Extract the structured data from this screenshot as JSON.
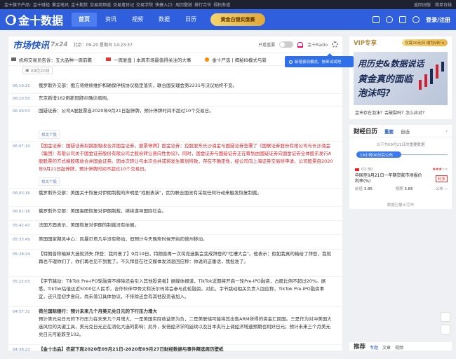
{
  "topbar": {
    "left": [
      "金十旗下产品:",
      "金十财经",
      "黄金电讯",
      "金十期货",
      "交易商频道",
      "交易者日记",
      "交易学院",
      "快捷入口:",
      "周历壁纸",
      "排行合伙",
      "视机有道"
    ],
    "right": [
      "返回旧版",
      "简单台线"
    ]
  },
  "nav": {
    "logo": "金十数据",
    "items": [
      "首页",
      "资讯",
      "视频",
      "数据",
      "日历"
    ],
    "active": 0,
    "promo": "黄金白银实盘赛",
    "login": "登录/注册"
  },
  "panel": {
    "brand": "市场快讯",
    "brand_sub": "7x24",
    "date": "北京：09-20 星期日 14:23:37",
    "important_label": "只看重要",
    "radio_label": "金十Radio",
    "tooltip": "新增夜间模式，快来试试吧",
    "ticker": [
      {
        "flag": "w",
        "text": "机构交易员告诉：五大品种一周前瞻"
      },
      {
        "flag": "r",
        "text": "一周复盘 | 本周市场最值得关注的大事"
      },
      {
        "flag": "c",
        "text": "金十严选 | 揭秘IB模式与新"
      }
    ],
    "date_filter": "09月20日"
  },
  "feed": [
    {
      "time": "06:19:21",
      "text": "俄罗斯外交部：俄方将继续维护和确保停核协议稳定落实，联合国安理会第2231号决议始终不变。",
      "style": "",
      "rel": ""
    },
    {
      "time": "06:10:50",
      "text": "东京新增162例新冠肺炎确诊病例。",
      "style": "",
      "rel": ""
    },
    {
      "time": "06:09:53",
      "text": "国疑证券：公司A股股票自2020年9月21日起停牌，预计停牌时间不超过10个交易日。",
      "style": "",
      "rel": "相关个股"
    },
    {
      "time": "06:07:10",
      "text": "【国金证券：国疑证券拟换股吸收合并国金证券，股票停牌】国金证券：控股股东长沙涌金与国疑证券签署了《国联证券股份有限公司与长沙涌金（集团）有限公司关于国金证券股份有限公司之股份转让意向性协议》，同时，国金证券与国疑证券正在筹划由国疑证券向国金证券全体股东发行A股股票的方式换股吸收合并国金证券。因本次转让与本次合并或将发生筹划所致，存在不确定性，经公司向上海证券交易所申请，公司股票自2020年9月21日起停牌，预计停牌时间不超过10个交易日。",
      "style": "red",
      "rel": "相关个股"
    },
    {
      "time": "06:03:16",
      "text": "俄罗斯外交部：美国关于恢复对伊朗制裁的声明是\"戏剧表演\"，因为联合国没有采取任何行动来触发恢复制裁。",
      "style": "",
      "rel": ""
    },
    {
      "time": "06:02:18",
      "text": "俄罗斯外交部：美国妄图恢复对伊朗制裁，继续谋导国际社会。",
      "style": "",
      "rel": ""
    },
    {
      "time": "05:42:47",
      "text": "法国方面表示，美国恢复对伊朗的制裁没有依据。",
      "style": "",
      "rel": ""
    },
    {
      "time": "05:33:49",
      "text": "美国国家飓风中心：风暴贝塔几乎没有移动，但预计今天晚些时候开始向德州移动。",
      "style": "",
      "rel": ""
    },
    {
      "time": "05:28:24",
      "text": "【特朗普称输掉大选就消失 拜登：我同意了】9月19日，特朗普再一次将竞选集会变成拜登的\"吐槽大会\"。他表示：假如我真的输给了拜登，我就再也不理你们了，你们再也见不到我了。不久拜登在社交媒体发消息回应称：你说的这番话，我批准了。",
      "style": "",
      "rel": ""
    },
    {
      "time": "05:22:03",
      "text": "【字节跳动：TikTok Pre-IPO轮融资不排除还会引入其他投资者】据媒体报道，TikTok近期将开启一轮Pre-IPO融资，占股比例不超过20%。据悉，TikTok估值达近5000亿人民币，合作伙伴甲骨文和沃尔玛将会参与此轮融资。对此，字节跳动相关负责人回应称，TikTok Pre-IPO融资事宜，还只是初步意向，尚未落订具体协议，不排除还会有其他投资者加入。",
      "style": "",
      "rel": ""
    },
    {
      "time": "04:57:31",
      "text": "荷兰国际银行：预计未来几个月美元兑日元的下行压力增大\n预计美元兑日元的下行压力在未来几个月增大，一是美国实际收益率为负，二是美联储可能将其出售ARM所得的资金汇回国。三是作为对冲美国大选风险的关键工具，美元兑日元正在消化大选的影响；此外，安倍经济学的延续以及日本央行上调经济增速预期也利好日元；预计未来三个月美元兑日元可能跌至102。",
      "style": "titled",
      "rel": ""
    },
    {
      "time": "04:38:22",
      "text": "【金十出品】农寂下周2020年09月21日-2020年09月27日财经数据与事件精选周历壁纸",
      "style": "bold",
      "rel": ""
    }
  ],
  "sidebar": {
    "vip_title": "VIP专享",
    "vip_badge": "仅需10元日  成为VIP >",
    "vip_img_lines": [
      "用历史&数据说话",
      "黄金真的面临",
      "泡沫吗?"
    ],
    "vip_caption": "金市存在泡沫？会破裂吗？怎么应对？",
    "cal_title": "财经日历",
    "cal_tabs": [
      "重要",
      "自选"
    ],
    "cal_sub": "以下为09月21日的重要数据",
    "cal_time": "19小时06分后公布",
    "events": [
      {
        "time": "01:30",
        "stars": 3,
        "title": "中国至9月21日一年期贷款市场报价利率(%)",
        "badge": "利多",
        "prev_label": "前值",
        "prev": "3.85",
        "exp_label": "预期",
        "exp": "3.85",
        "act_label": "公布",
        "act": "--"
      },
      {
        "time": "--:--",
        "stars": 0,
        "title": "",
        "badge": "",
        "prev_label": "未公布",
        "prev": "",
        "exp_label": "",
        "exp": "",
        "act_label": "",
        "act": ""
      }
    ],
    "cal_more": "数据已展示完毕",
    "rec_title": "推荐",
    "rec_tabs": [
      "专题",
      "文章",
      "视频"
    ]
  }
}
